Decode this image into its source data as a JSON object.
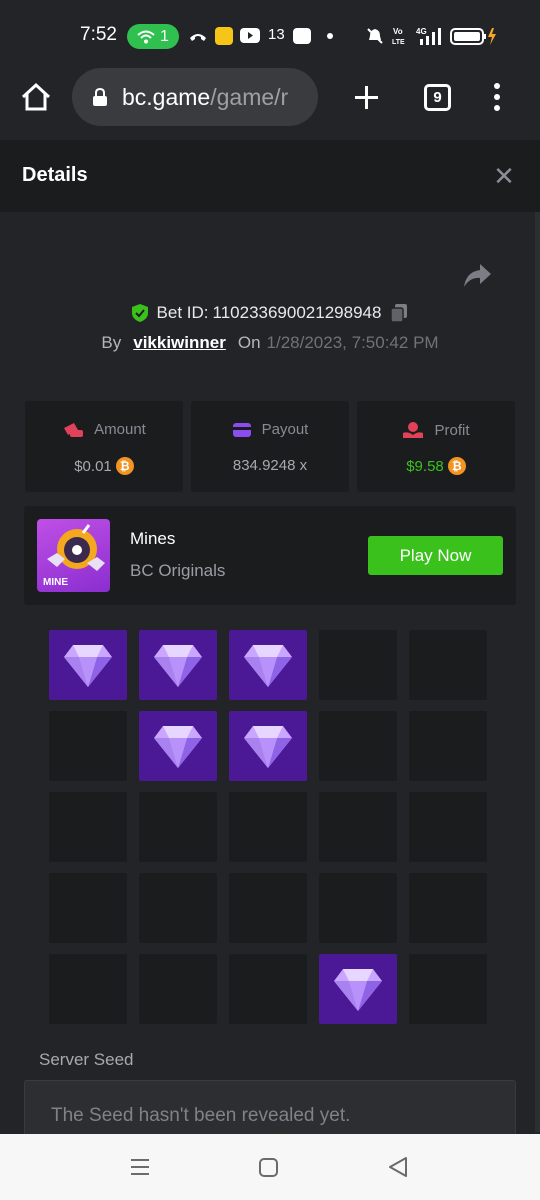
{
  "status_bar": {
    "time": "7:52",
    "wifi_count": "1",
    "notif_count": "13"
  },
  "browser": {
    "url_host": "bc.game",
    "url_path": "/game/r",
    "tab_count": "9"
  },
  "modal": {
    "title": "Details",
    "close_label": "✕"
  },
  "bet": {
    "id_label": "Bet ID:",
    "id": "110233690021298948",
    "by_label": "By",
    "user": "vikkiwinner",
    "on_label": "On",
    "date": "1/28/2023, 7:50:42 PM"
  },
  "stats": [
    {
      "label": "Amount",
      "value": "$0.01",
      "coin": "bitcoin"
    },
    {
      "label": "Payout",
      "value": "834.9248 x"
    },
    {
      "label": "Profit",
      "value": "$9.58",
      "coin": "bitcoin"
    }
  ],
  "colors": {
    "accent_green": "#3bc11c",
    "profit_green": "#3bc11c",
    "gem_tile": "#4b1896",
    "tile": "#1b1c1e",
    "bitcoin": "#f39321"
  },
  "game": {
    "name": "Mines",
    "provider": "BC Originals",
    "thumb_label": "MINE",
    "play_label": "Play Now"
  },
  "mines_grid": {
    "rows": 5,
    "cols": 5,
    "revealed_gems": [
      [
        0,
        0
      ],
      [
        0,
        1
      ],
      [
        0,
        2
      ],
      [
        1,
        1
      ],
      [
        1,
        2
      ],
      [
        4,
        3
      ]
    ]
  },
  "server_seed": {
    "label": "Server Seed",
    "message": "The Seed hasn't been revealed yet."
  }
}
